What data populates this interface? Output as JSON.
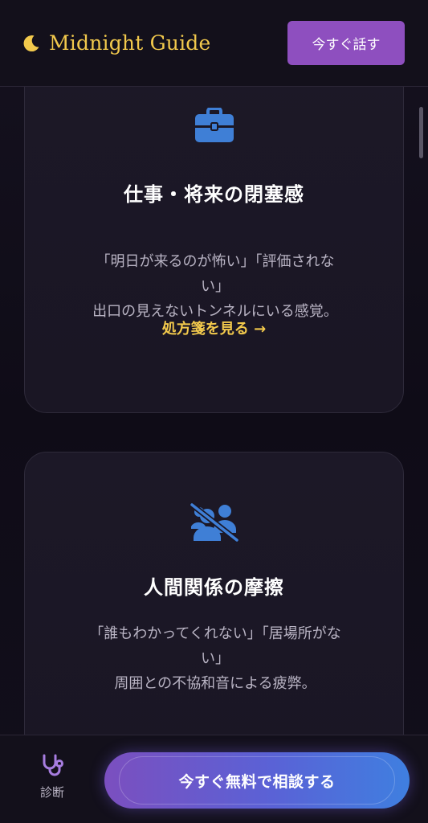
{
  "header": {
    "brand": "Midnight Guide",
    "talk_button": "今すぐ話す"
  },
  "cards": [
    {
      "icon": "briefcase-icon",
      "title": "仕事・将来の閉塞感",
      "desc_line1": "「明日が来るのが怖い」「評価されな",
      "desc_line2": "い」",
      "desc_line3": "出口の見えないトンネルにいる感覚。",
      "link": "処方箋を見る →"
    },
    {
      "icon": "users-slash-icon",
      "title": "人間関係の摩擦",
      "desc_line1": "「誰もわかってくれない」「居場所がな",
      "desc_line2": "い」",
      "desc_line3": "周囲との不協和音による疲弊。"
    }
  ],
  "bottom_nav": {
    "diagnosis_label": "診断",
    "cta": "今すぐ無料で相談する"
  },
  "colors": {
    "accent_gold": "#f2c94c",
    "accent_purple": "#8e4fbf",
    "icon_blue": "#3f7fd6",
    "background": "#0f0c17"
  }
}
